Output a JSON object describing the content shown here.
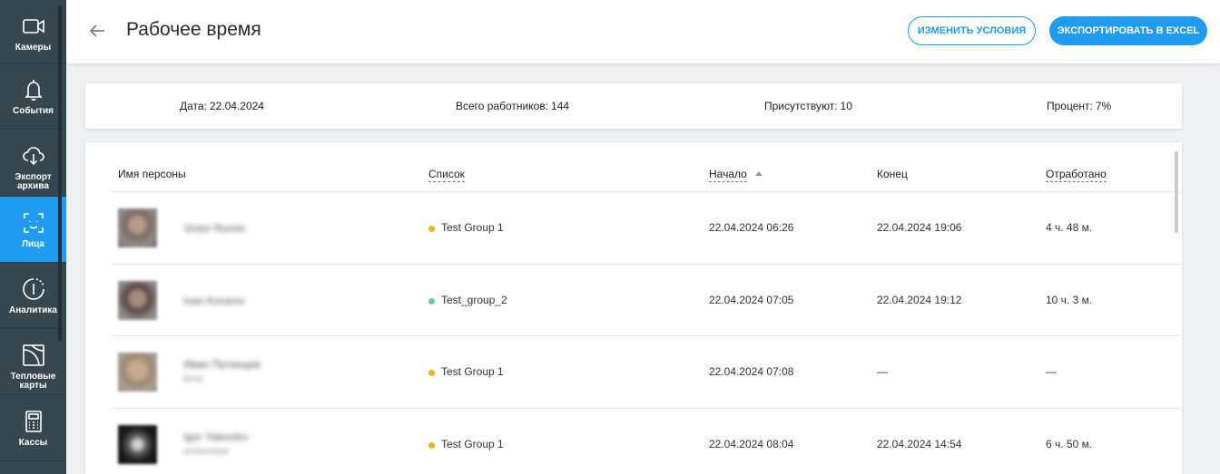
{
  "sidebar": {
    "items": [
      {
        "label": "Камеры",
        "icon": "camera-icon"
      },
      {
        "label": "События",
        "icon": "bell-icon"
      },
      {
        "label": "Экспорт архива",
        "icon": "cloud-download-icon"
      },
      {
        "label": "Лица",
        "icon": "face-scan-icon",
        "active": true
      },
      {
        "label": "Аналитика",
        "icon": "analytics-icon"
      },
      {
        "label": "Тепловые карты",
        "icon": "heatmap-icon"
      },
      {
        "label": "Кассы",
        "icon": "cash-register-icon"
      }
    ]
  },
  "header": {
    "title": "Рабочее время",
    "change_conditions": "ИЗМЕНИТЬ УСЛОВИЯ",
    "export_excel": "ЭКСПОРТИРОВАТЬ В EXCEL"
  },
  "summary": {
    "date_label": "Дата:",
    "date_value": "22.04.2024",
    "total_label": "Всего работников:",
    "total_value": "144",
    "present_label": "Присутствуют:",
    "present_value": "10",
    "percent_label": "Процент:",
    "percent_value": "7%"
  },
  "table": {
    "columns": {
      "name": "Имя персоны",
      "list": "Список",
      "start": "Начало",
      "end": "Конец",
      "worked": "Отработано"
    },
    "rows": [
      {
        "name": "Victor Rumin",
        "sub": "",
        "list": "Test Group 1",
        "dot_color": "#f2b01e",
        "start": "22.04.2024 06:26",
        "end": "22.04.2024 19:06",
        "worked": "4 ч. 48 м."
      },
      {
        "name": "Ivan Korarov",
        "sub": "",
        "list": "Test_group_2",
        "dot_color": "#5fd0a8",
        "start": "22.04.2024 07:05",
        "end": "22.04.2024 19:12",
        "worked": "10 ч. 3 м."
      },
      {
        "name": "Иван Путинцев",
        "sub": "Бета",
        "list": "Test Group 1",
        "dot_color": "#f2b01e",
        "start": "22.04.2024 07:08",
        "end": "—",
        "worked": "—"
      },
      {
        "name": "Igor Yakovlev",
        "sub": "workerdept",
        "list": "Test Group 1",
        "dot_color": "#f2b01e",
        "start": "22.04.2024 08:04",
        "end": "22.04.2024 14:54",
        "worked": "6 ч. 50 м."
      }
    ]
  },
  "colors": {
    "accent": "#1f9bef",
    "sidebar": "#37474f"
  }
}
